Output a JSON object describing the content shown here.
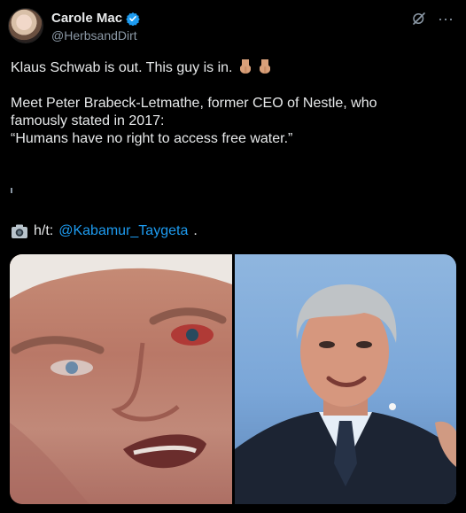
{
  "post": {
    "author": {
      "display_name": "Carole Mac",
      "handle": "@HerbsandDirt",
      "verified_icon": "verified-badge-icon",
      "avatar_icon": "avatar"
    },
    "actions": {
      "grok_icon": "grok-icon",
      "more_icon": "more-options-icon",
      "more_label": "···"
    },
    "text": {
      "line1": "Klaus Schwab is out. This guy is in.",
      "line1_emoji": "👇🏼👇🏼",
      "line2": "Meet Peter Brabeck-Letmathe, former CEO of Nestle, who",
      "line3": "famously stated in 2017:",
      "line4": "“Humans have no right to access free water.”",
      "ht_label": "h/t:",
      "ht_mention": "@Kabamur_Taygeta",
      "ht_suffix": "."
    },
    "media": {
      "left_photo": "close-up face photo",
      "right_photo": "man in suit photo"
    }
  },
  "colors": {
    "background": "#000000",
    "text": "#e7e9ea",
    "secondary": "#8b98a5",
    "accent": "#1d9bf0"
  }
}
